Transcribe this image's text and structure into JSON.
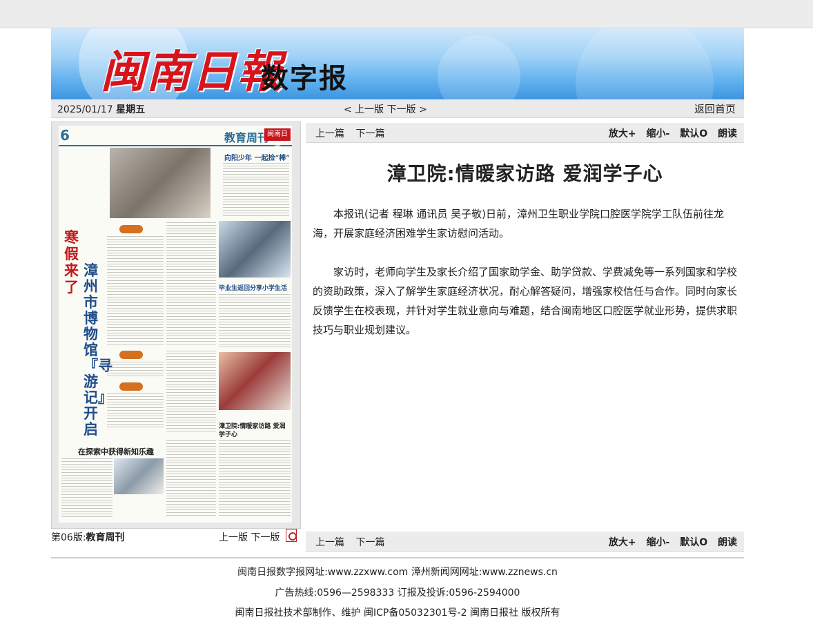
{
  "banner": {
    "title_red": "闽南日報",
    "title_black": "数字报"
  },
  "datebar": {
    "date": "2025/01/17",
    "weekday": "星期五",
    "prev_page": "< 上一版",
    "next_page": "下一版 >",
    "home": "返回首页"
  },
  "paper": {
    "page_label": "第06版:",
    "page_name": "教育周刊",
    "prev": "上一版",
    "next": "下一版",
    "thumb": {
      "page_number": "6",
      "column_title": "教育周刊",
      "masthead": "闽南日報",
      "headline_vertical_red": "寒假来了",
      "headline_vertical_blue": "漳州市博物馆『寻游记』开启",
      "headline_a": "向阳少年 一起捡“棒”",
      "headline_b": "毕业生返回分享小学生活",
      "headline_c": "漳卫院:情暖家访路 爱润学子心",
      "headline_d": "在探索中获得新知乐趣"
    }
  },
  "toolbar": {
    "prev_article": "上一篇",
    "next_article": "下一篇",
    "zoom_in": "放大+",
    "zoom_out": "缩小-",
    "default": "默认O",
    "read": "朗读"
  },
  "article": {
    "title": "漳卫院:情暖家访路 爱润学子心",
    "p1": "本报讯(记者 程琳 通讯员 吴子敬)日前，漳州卫生职业学院口腔医学院学工队伍前往龙海，开展家庭经济困难学生家访慰问活动。",
    "p2": "家访时，老师向学生及家长介绍了国家助学金、助学贷款、学费减免等一系列国家和学校的资助政策，深入了解学生家庭经济状况，耐心解答疑问，增强家校信任与合作。同时向家长反馈学生在校表现，并针对学生就业意向与难题，结合闽南地区口腔医学就业形势，提供求职技巧与职业规划建议。"
  },
  "footer": {
    "line1": "闽南日报数字报网址:www.zzxww.com 漳州新闻网网址:www.zznews.cn",
    "line2": "广告热线:0596—2598333 订报及投诉:0596-2594000",
    "line3": "闽南日报社技术部制作、维护 闽ICP备05032301号-2 闽南日报社 版权所有"
  }
}
